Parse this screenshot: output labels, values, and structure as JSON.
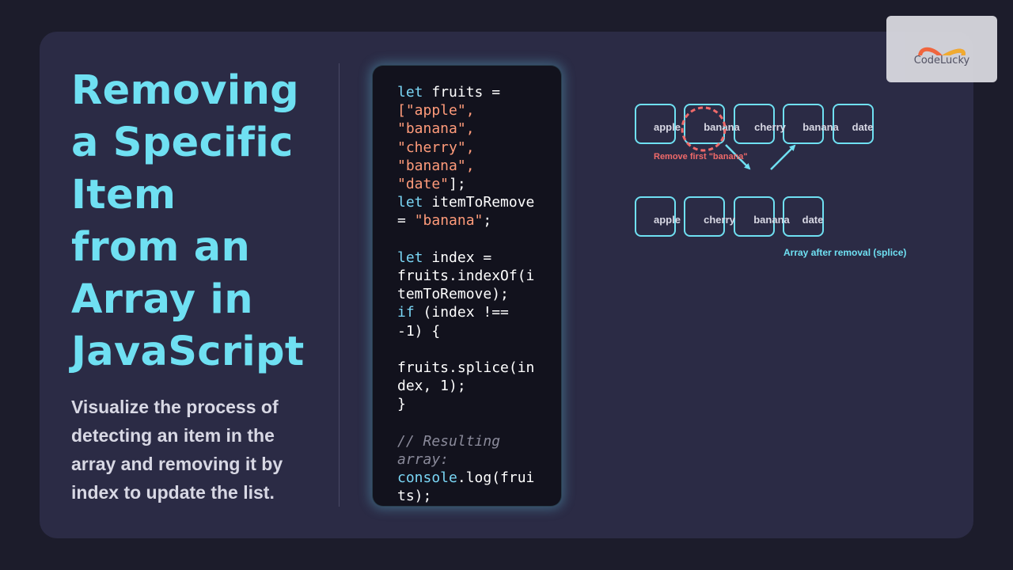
{
  "title_lines": [
    "Removing",
    "a Specific",
    "Item",
    "from an",
    "Array in",
    "JavaScript"
  ],
  "subtitle": "Visualize the process of detecting an item in the array and removing it by index to update the list.",
  "code": {
    "l1_kw": "let",
    "l1_rest": " fruits =",
    "l2": "[\"apple\",",
    "l3": "\"banana\",",
    "l4": "\"cherry\",",
    "l5": "\"banana\",",
    "l6_str": "\"date\"",
    "l6_rest": "];",
    "l7_kw": "let",
    "l7_rest": " itemToRemove",
    "l8_a": "= ",
    "l8_str": "\"banana\"",
    "l8_b": ";",
    "l10_kw": "let",
    "l10_rest": " index =",
    "l11": "fruits.indexOf(i",
    "l12": "temToRemove);",
    "l13_kw": "if",
    "l13_rest": " (index !==",
    "l14": "-1) {",
    "l16": "fruits.splice(in",
    "l17": "dex, 1);",
    "l18": "}",
    "l20": "// Resulting",
    "l21": "array:",
    "l22_fn": "console",
    "l22_rest": ".log(frui",
    "l23": "ts);"
  },
  "diagram": {
    "top_row": [
      "apple",
      "banana",
      "cherry",
      "banana",
      "date"
    ],
    "bottom_row": [
      "apple",
      "cherry",
      "banana",
      "date"
    ],
    "remove_note": "Remove first \"banana\"",
    "result_note": "Array after removal (splice)"
  },
  "logo": {
    "text": "CodeLucky",
    "icon": "infinity-logo-icon"
  },
  "colors": {
    "accent": "#6fe0f2",
    "remove": "#f06a6a",
    "background": "#2b2b45"
  }
}
